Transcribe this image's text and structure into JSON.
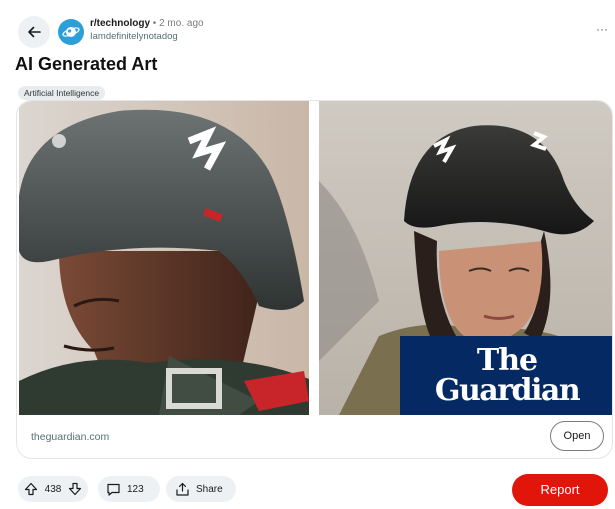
{
  "header": {
    "subreddit": "r/technology",
    "separator": "•",
    "time": "2 mo. ago",
    "username": "Iamdefinitelynotadog",
    "more_label": "···"
  },
  "post": {
    "title": "AI Generated Art",
    "flair": "Artificial Intelligence"
  },
  "media": {
    "watermark_line1": "The",
    "watermark_line2": "Guardian"
  },
  "link": {
    "domain": "theguardian.com",
    "open_label": "Open"
  },
  "actions": {
    "score": "438",
    "comments": "123",
    "share_label": "Share",
    "report_label": "Report"
  },
  "colors": {
    "report": "#e2150a",
    "guardian_bg": "#052962",
    "subreddit_icon": "#2d9fd8"
  }
}
